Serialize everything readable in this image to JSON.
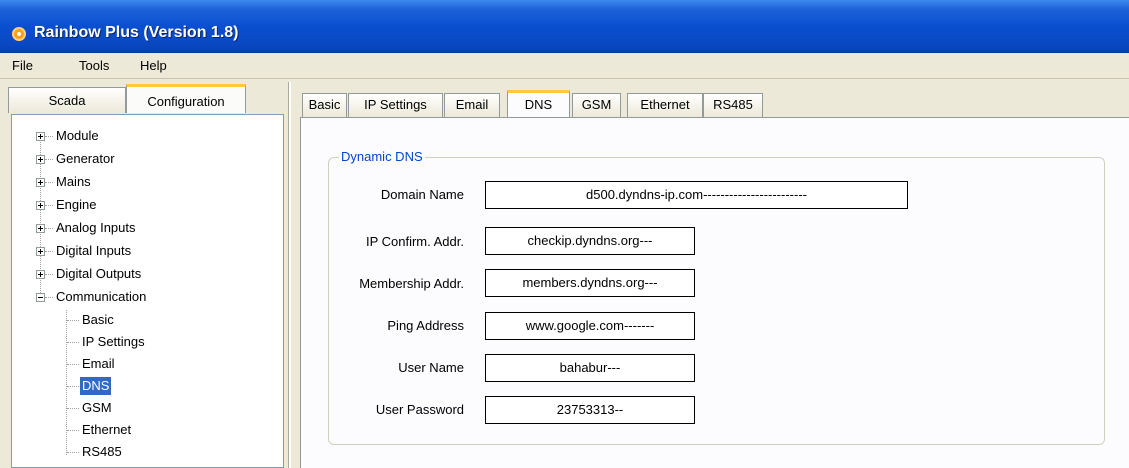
{
  "window": {
    "title": "Rainbow Plus (Version 1.8)"
  },
  "menu": [
    "File",
    "Tools",
    "Help"
  ],
  "left_tabs": [
    {
      "label": "Scada",
      "active": false
    },
    {
      "label": "Configuration",
      "active": true
    }
  ],
  "tree": {
    "top": [
      "Module",
      "Generator",
      "Mains",
      "Engine",
      "Analog Inputs",
      "Digital Inputs",
      "Digital Outputs",
      "Communication"
    ],
    "communication_children": [
      "Basic",
      "IP Settings",
      "Email",
      "DNS",
      "GSM",
      "Ethernet",
      "RS485"
    ],
    "selected": "DNS"
  },
  "right_tabs": [
    "Basic",
    "IP Settings",
    "Email",
    "DNS",
    "GSM",
    "Ethernet",
    "RS485"
  ],
  "active_right_tab": "DNS",
  "dns": {
    "group_title": "Dynamic DNS",
    "fields": [
      {
        "label": "Domain Name",
        "value": "d500.dyndns-ip.com------------------------"
      },
      {
        "label": "IP Confirm. Addr.",
        "value": "checkip.dyndns.org---"
      },
      {
        "label": "Membership Addr.",
        "value": "members.dyndns.org---"
      },
      {
        "label": "Ping Address",
        "value": "www.google.com-------"
      },
      {
        "label": "User Name",
        "value": "bahabur---"
      },
      {
        "label": "User Password",
        "value": "23753313--"
      }
    ]
  },
  "colors": {
    "title_bar": "#0a4fd0",
    "accent": "#0046d5",
    "selection": "#316ac5",
    "tab_highlight": "#ffc83c"
  }
}
